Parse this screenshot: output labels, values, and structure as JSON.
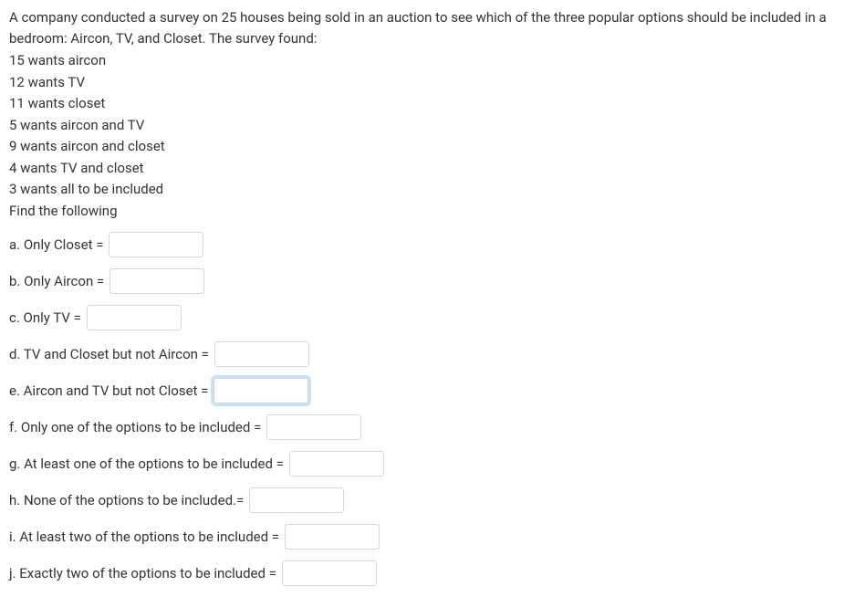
{
  "intro": "A company conducted a survey on 25 houses being sold in an auction to see which of the three popular options should be included in a bedroom: Aircon, TV, and Closet. The survey found:",
  "surveyLines": {
    "l1": "15 wants aircon",
    "l2": "12 wants TV",
    "l3": "11 wants closet",
    "l4": "5 wants aircon and TV",
    "l5": "9 wants aircon and closet",
    "l6": "4 wants TV and closet",
    "l7": "3 wants all to be included",
    "l8": "Find the following"
  },
  "questions": {
    "a": "a. Only Closet =",
    "b": "b. Only Aircon =",
    "c": "c. Only TV =",
    "d": "d. TV and Closet but not Aircon =",
    "e": "e. Aircon and TV but not Closet =",
    "f": "f. Only one of the options to be included =",
    "g": "g. At least one of the options to be included =",
    "h": "h. None of the options to be included.=",
    "i": "i. At least two of the options to be included =",
    "j": "j. Exactly two of the options to be included ="
  },
  "answers": {
    "a": "",
    "b": "",
    "c": "",
    "d": "",
    "e": "",
    "f": "",
    "g": "",
    "h": "",
    "i": "",
    "j": ""
  }
}
